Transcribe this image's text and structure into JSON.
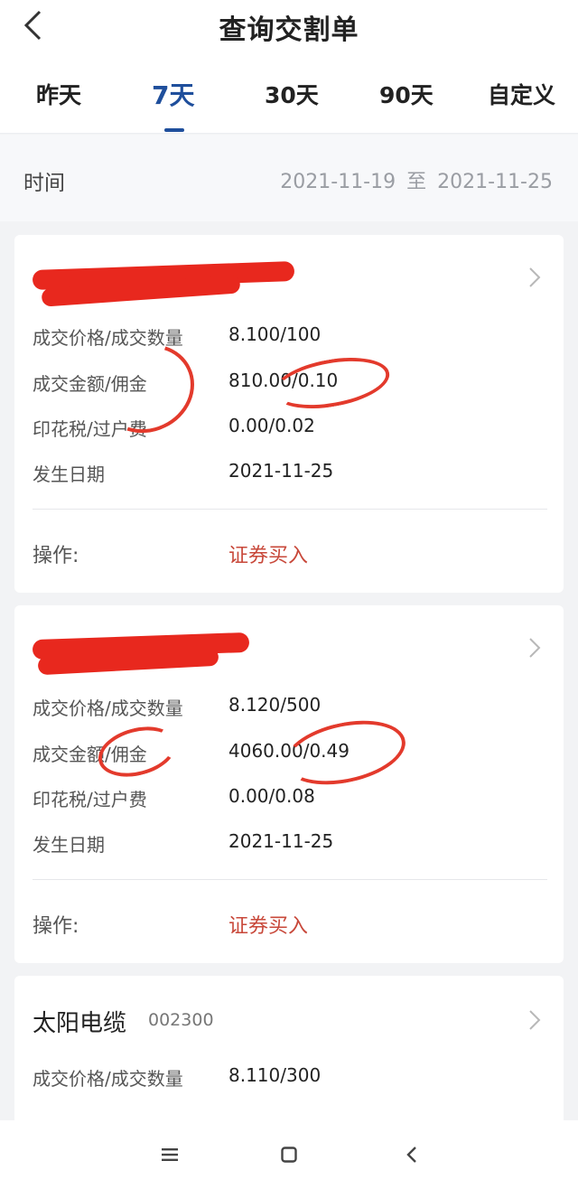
{
  "header": {
    "title": "查询交割单",
    "back_icon": "chevron-left-icon"
  },
  "tabs": [
    {
      "label": "昨天",
      "active": false
    },
    {
      "label": "7天",
      "active": true
    },
    {
      "label": "30天",
      "active": false
    },
    {
      "label": "90天",
      "active": false
    },
    {
      "label": "自定义",
      "active": false
    }
  ],
  "time_filter": {
    "label": "时间",
    "start": "2021-11-19",
    "separator": "至",
    "end": "2021-11-25"
  },
  "labels": {
    "price_qty": "成交价格/成交数量",
    "amount_commission": "成交金额/佣金",
    "stamp_transfer": "印花税/过户费",
    "date": "发生日期",
    "operation": "操作:"
  },
  "trades": [
    {
      "name": "",
      "code": "",
      "redacted": true,
      "price_qty": "8.100/100",
      "amount_commission": "810.00/0.10",
      "stamp_transfer": "0.00/0.02",
      "date": "2021-11-25",
      "operation": "证券买入"
    },
    {
      "name": "",
      "code": "",
      "redacted": true,
      "price_qty": "8.120/500",
      "amount_commission": "4060.00/0.49",
      "stamp_transfer": "0.00/0.08",
      "date": "2021-11-25",
      "operation": "证券买入"
    },
    {
      "name": "太阳电缆",
      "code": "002300",
      "redacted": false,
      "price_qty": "8.110/300"
    }
  ],
  "colors": {
    "accent": "#1f4f9c",
    "operation": "#c8483a",
    "annotation": "#e33a2c"
  },
  "navbar": {
    "icons": [
      "menu-icon",
      "home-square-icon",
      "back-triangle-icon"
    ]
  }
}
